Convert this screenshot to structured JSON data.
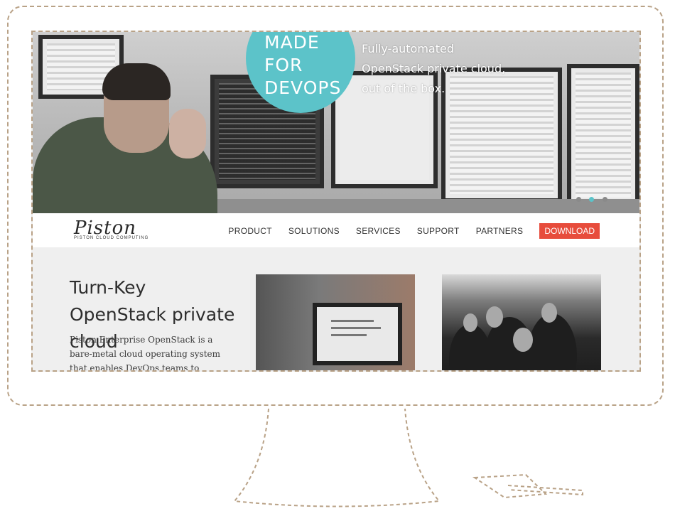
{
  "hero": {
    "badge_lines": [
      "MADE",
      "FOR",
      "DEVOPS"
    ],
    "tagline": "Fully-automated OpenStack private cloud, out of the box.",
    "accent_color": "#5cc3c9",
    "slider_dots": 3,
    "active_dot": 1
  },
  "nav": {
    "logo_text": "Piston",
    "logo_sub": "PISTON CLOUD COMPUTING",
    "items": [
      "PRODUCT",
      "SOLUTIONS",
      "SERVICES",
      "SUPPORT",
      "PARTNERS"
    ],
    "download": "DOWNLOAD",
    "download_color": "#e74c3c"
  },
  "content": {
    "heading": "Turn-Key OpenStack private cloud",
    "body": "Piston Enterprise OpenStack is a bare-metal cloud operating system that enables DevOps teams to easily deploy"
  },
  "outline_color": "#b9a287"
}
